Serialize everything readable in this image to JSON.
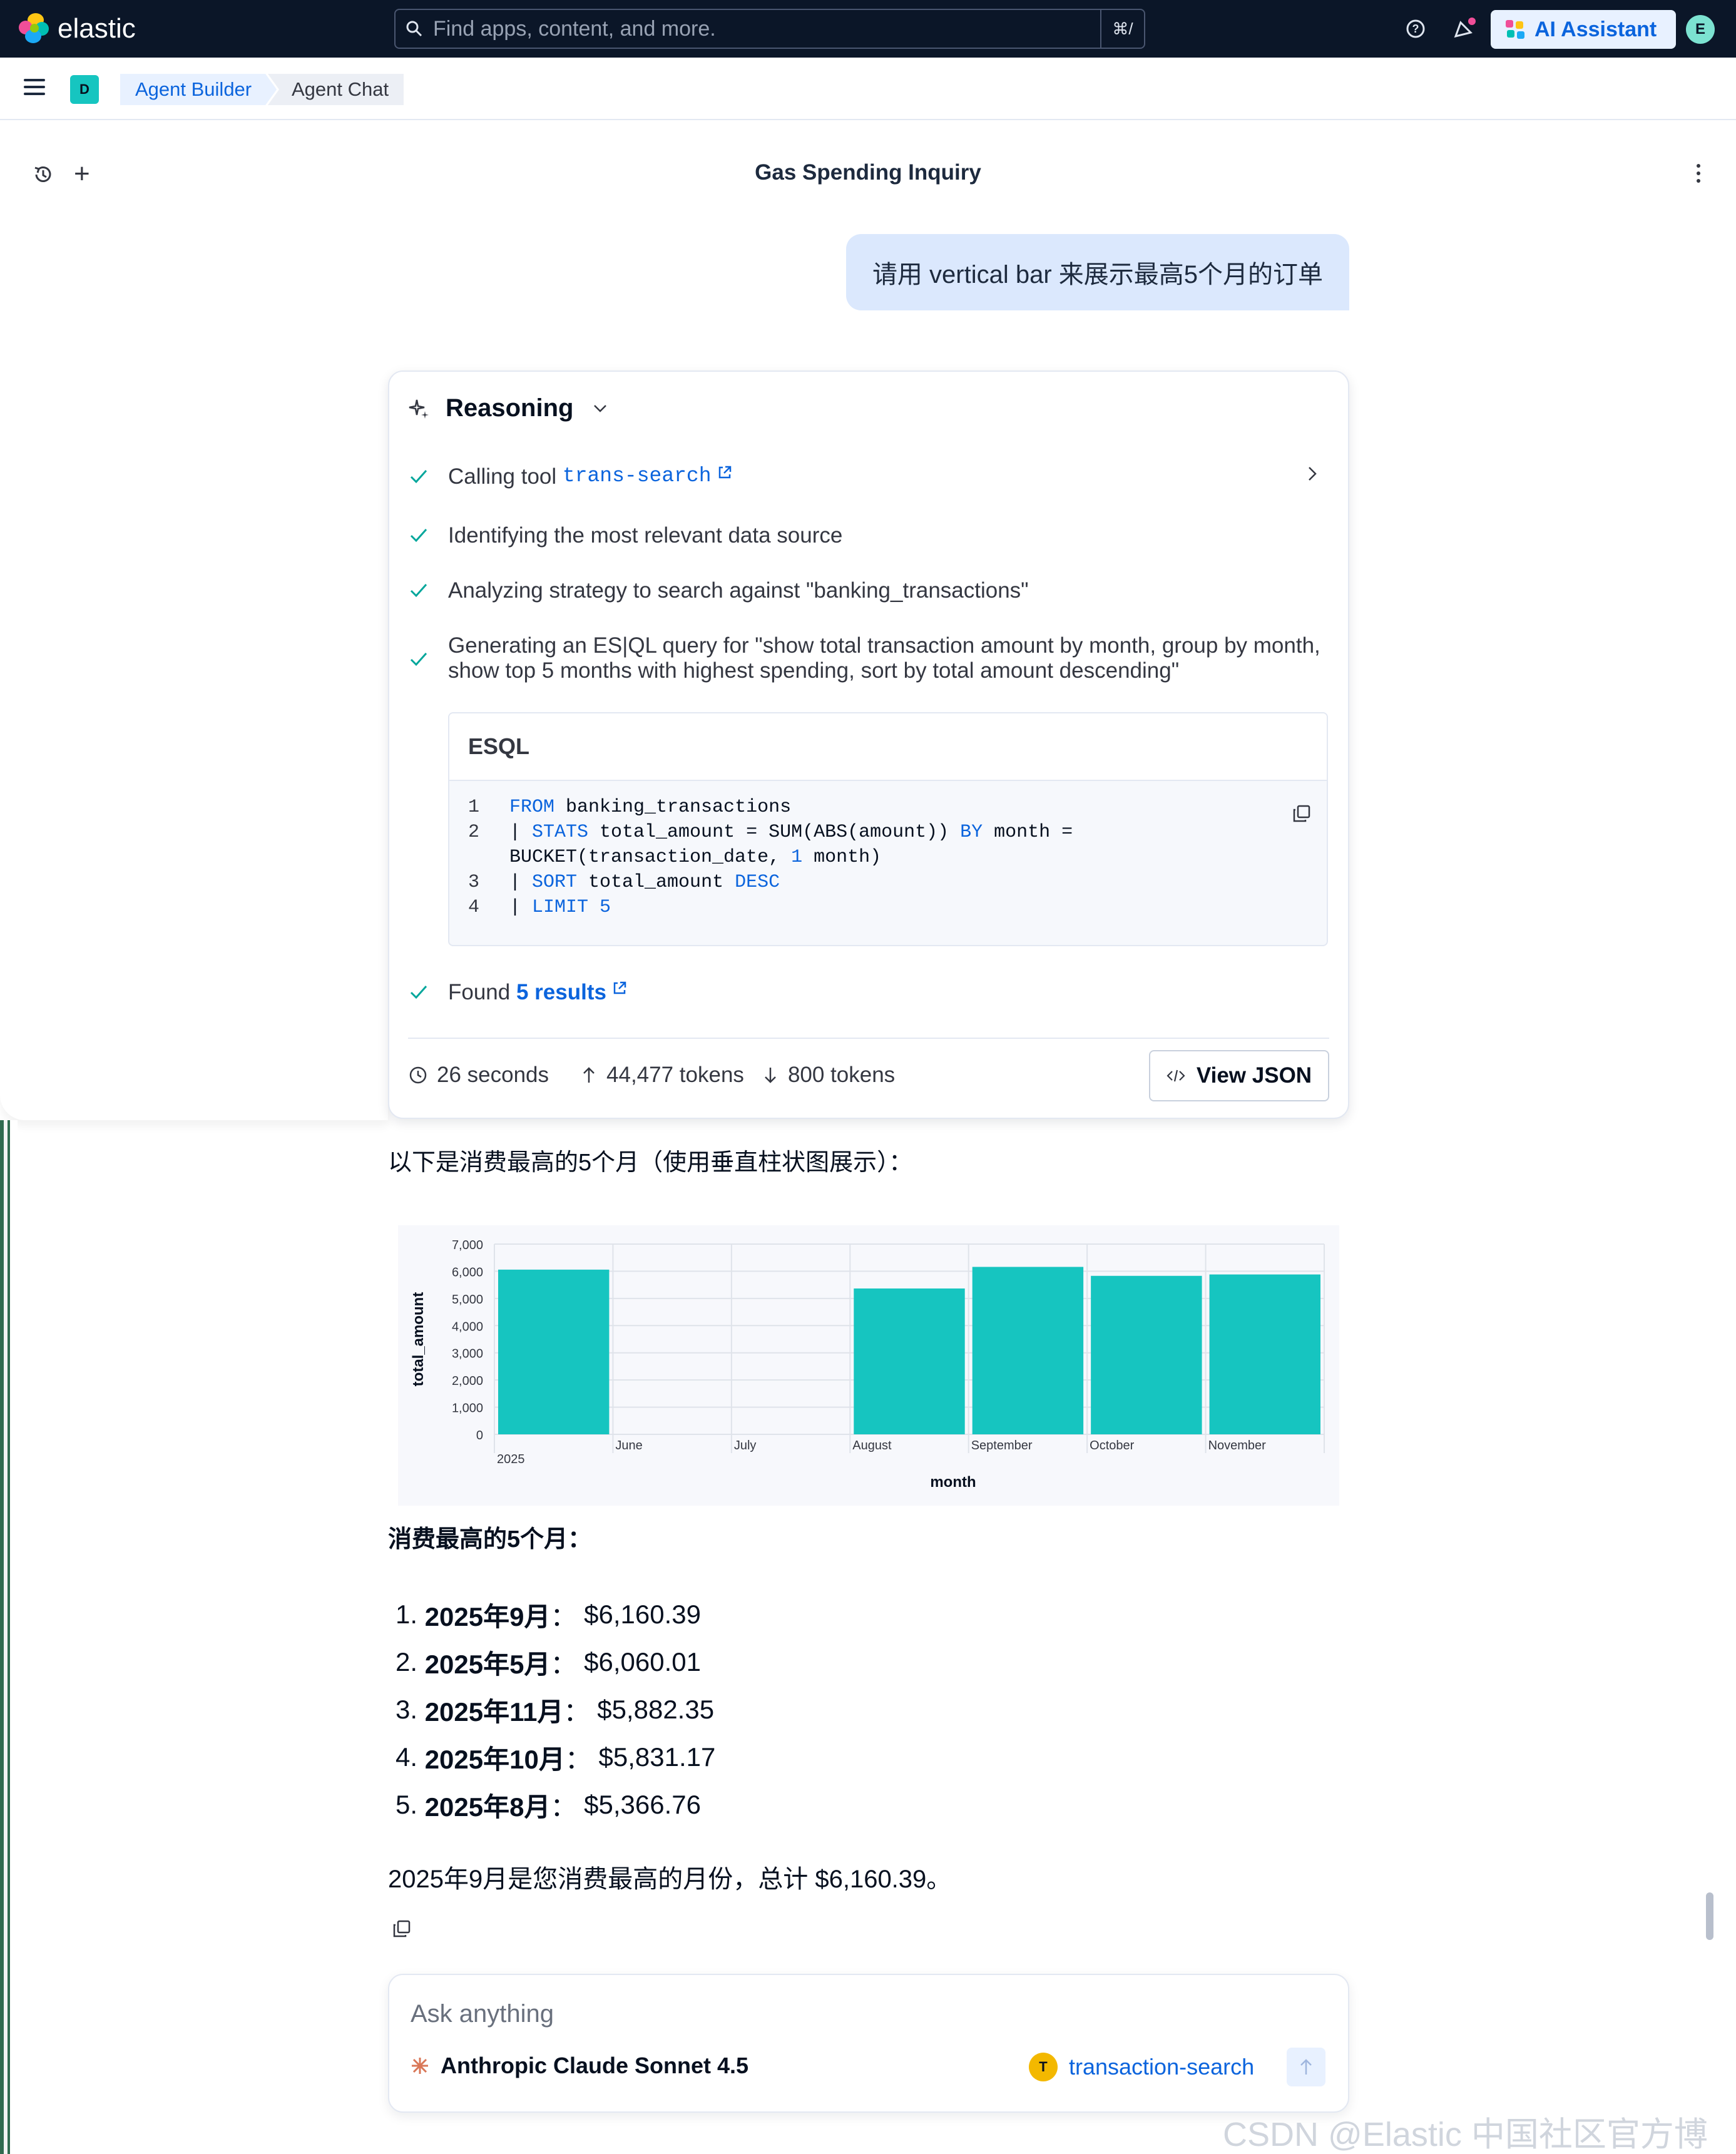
{
  "topbar": {
    "logo_text": "elastic",
    "search_placeholder": "Find apps, content, and more.",
    "search_shortcut": "⌘/",
    "ai_button_label": "AI Assistant",
    "user_initial": "E"
  },
  "breadcrumb": {
    "space_initial": "D",
    "items": [
      {
        "label": "Agent Builder"
      },
      {
        "label": "Agent Chat"
      }
    ]
  },
  "conversation": {
    "title": "Gas Spending Inquiry",
    "user_message": "请用 vertical bar 来展示最高5个月的订单"
  },
  "reasoning": {
    "title": "Reasoning",
    "steps": {
      "calling_prefix": "Calling tool",
      "calling_tool": "trans-search",
      "identify": "Identifying the most relevant data source",
      "analyze": "Analyzing strategy to search against \"banking_transactions\"",
      "generate": "Generating an ES|QL query for \"show total transaction amount by month, group by month, show top 5 months with highest spending, sort by total amount descending\"",
      "found_prefix": "Found",
      "found_link": "5 results"
    },
    "esql": {
      "label": "ESQL",
      "lines": [
        {
          "n": "1",
          "text": "FROM banking_transactions"
        },
        {
          "n": "2",
          "text": "| STATS total_amount = SUM(ABS(amount)) BY month ="
        },
        {
          "n": "",
          "text": "BUCKET(transaction_date, 1 month)"
        },
        {
          "n": "3",
          "text": "| SORT total_amount DESC"
        },
        {
          "n": "4",
          "text": "| LIMIT 5"
        }
      ]
    },
    "stats": {
      "duration": "26 seconds",
      "tokens_in": "44,477 tokens",
      "tokens_out": "800 tokens"
    },
    "view_json_label": "View JSON"
  },
  "answer": {
    "intro": "以下是消费最高的5个月（使用垂直柱状图展示）：",
    "heading": "消费最高的5个月：",
    "items": [
      {
        "num": "1.",
        "label": "2025年9月",
        "value": "$6,160.39"
      },
      {
        "num": "2.",
        "label": "2025年5月",
        "value": "$6,060.01"
      },
      {
        "num": "3.",
        "label": "2025年11月",
        "value": "$5,882.35"
      },
      {
        "num": "4.",
        "label": "2025年10月",
        "value": "$5,831.17"
      },
      {
        "num": "5.",
        "label": "2025年8月",
        "value": "$5,366.76"
      }
    ],
    "summary": "2025年9月是您消费最高的月份，总计 $6,160.39。"
  },
  "chart_data": {
    "type": "bar",
    "categories": [
      "2025",
      "June",
      "July",
      "August",
      "September",
      "October",
      "November"
    ],
    "values": [
      6060.01,
      0,
      0,
      5366.76,
      6160.39,
      5831.17,
      5882.35
    ],
    "xlabel": "month",
    "ylabel": "total_amount",
    "ylim": [
      0,
      7000
    ],
    "yticks": [
      "0",
      "1,000",
      "2,000",
      "3,000",
      "4,000",
      "5,000",
      "6,000",
      "7,000"
    ],
    "grid": true,
    "bar_color": "#16c5c0"
  },
  "input": {
    "placeholder": "Ask anything",
    "model": "Anthropic Claude Sonnet 4.5",
    "agent_initial": "T",
    "agent": "transaction-search"
  },
  "watermark": "CSDN @Elastic 中国社区官方博客"
}
